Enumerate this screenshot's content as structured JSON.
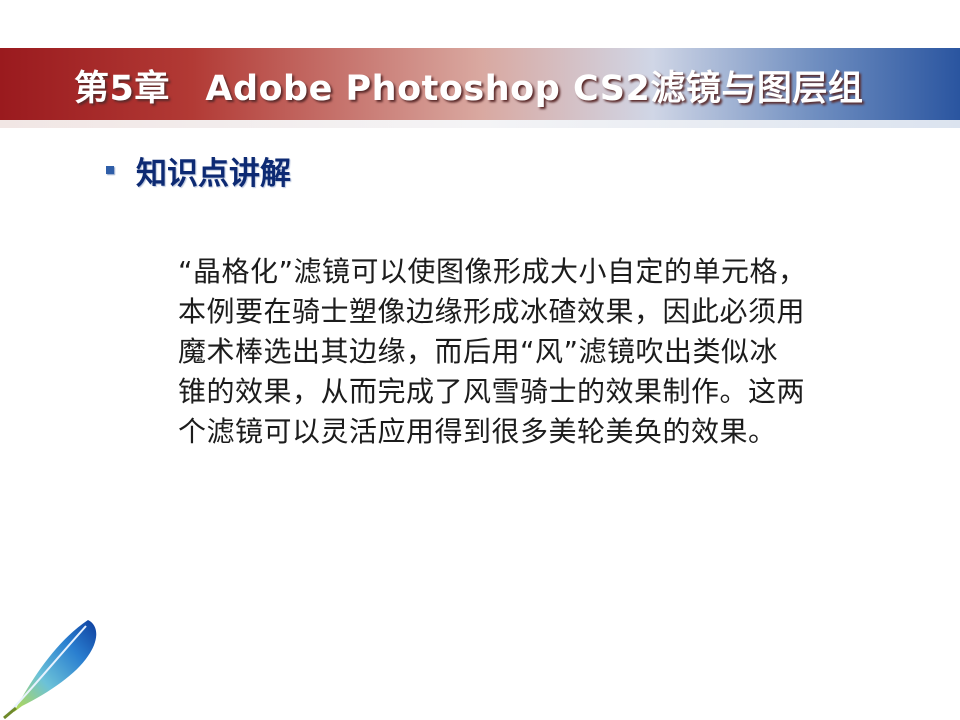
{
  "slide": {
    "title": "第5章　Adobe Photoshop CS2滤镜与图层组",
    "section_title": "知识点讲解",
    "body_lines": [
      "“晶格化”滤镜可以使图像形成大小自定的单元格，",
      "本例要在骑士塑像边缘形成冰碴效果，因此必须用",
      "魔术棒选出其边缘，而后用“风”滤镜吹出类似冰",
      "锥的效果，从而完成了风雪骑士的效果制作。这两",
      "个滤镜可以灵活应用得到很多美轮美奂的效果。"
    ]
  },
  "theme": {
    "title_band_left": "#9a1a1e",
    "title_band_right": "#2a55a0",
    "section_title_color": "#0d2a73",
    "bullet_color": "#2f5ea8"
  },
  "decor": {
    "corner_icon": "feather-icon"
  }
}
